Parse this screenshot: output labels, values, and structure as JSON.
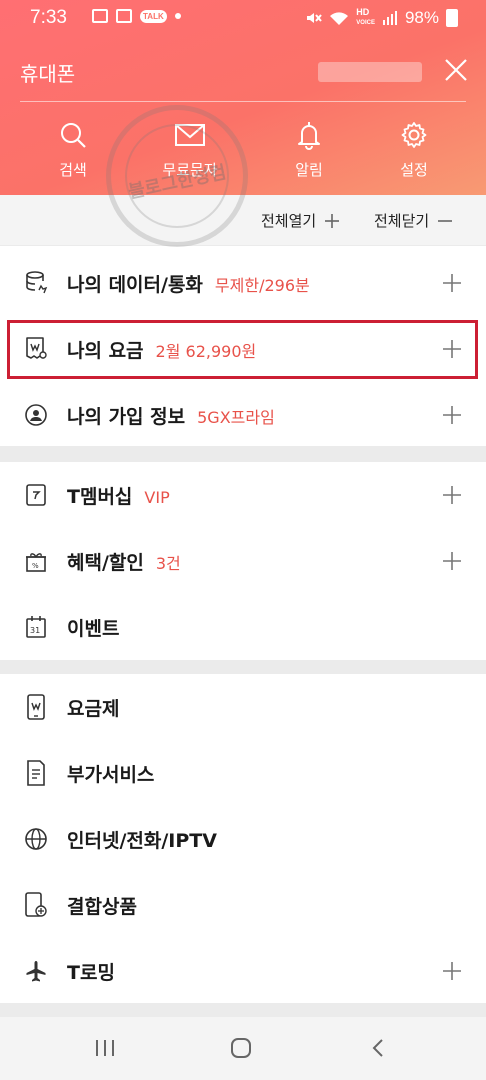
{
  "status_bar": {
    "time": "7:33",
    "battery": "98%",
    "hd_top": "HD",
    "hd_bottom": "VOICE",
    "talk": "TALK"
  },
  "header": {
    "title": "휴대폰",
    "quick_actions": [
      {
        "label": "검색",
        "icon": "search-icon"
      },
      {
        "label": "무료문자",
        "icon": "mail-icon"
      },
      {
        "label": "알림",
        "icon": "bell-icon"
      },
      {
        "label": "설정",
        "icon": "gear-icon"
      }
    ]
  },
  "toggles": {
    "expand_all": "전체열기",
    "collapse_all": "전체닫기"
  },
  "section1": [
    {
      "label": "나의 데이터/통화",
      "value": "무제한/296분",
      "icon": "database-icon",
      "expandable": true
    },
    {
      "label": "나의 요금",
      "value": "2월 62,990원",
      "icon": "bill-icon",
      "expandable": true
    },
    {
      "label": "나의 가입 정보",
      "value": "5GX프라임",
      "icon": "user-circle-icon",
      "expandable": true
    }
  ],
  "section2": [
    {
      "label": "T멤버십",
      "value": "VIP",
      "icon": "membership-card-icon",
      "expandable": true
    },
    {
      "label": "혜택/할인",
      "value": "3건",
      "icon": "gift-icon",
      "expandable": true
    },
    {
      "label": "이벤트",
      "value": "",
      "icon": "calendar-icon",
      "calendar_day": "31",
      "expandable": false
    }
  ],
  "section3": [
    {
      "label": "요금제",
      "icon": "phone-plan-icon",
      "expandable": false
    },
    {
      "label": "부가서비스",
      "icon": "document-icon",
      "expandable": false
    },
    {
      "label": "인터넷/전화/IPTV",
      "icon": "globe-icon",
      "expandable": false
    },
    {
      "label": "결합상품",
      "icon": "phone-add-icon",
      "expandable": false
    },
    {
      "label": "T로밍",
      "icon": "airplane-icon",
      "expandable": true
    }
  ],
  "watermark": {
    "text": "블로그한성컴"
  },
  "colors": {
    "header_start": "#ff6f73",
    "header_end": "#f89a73",
    "accent": "#e8524a",
    "highlight_border": "#cc1f34"
  }
}
